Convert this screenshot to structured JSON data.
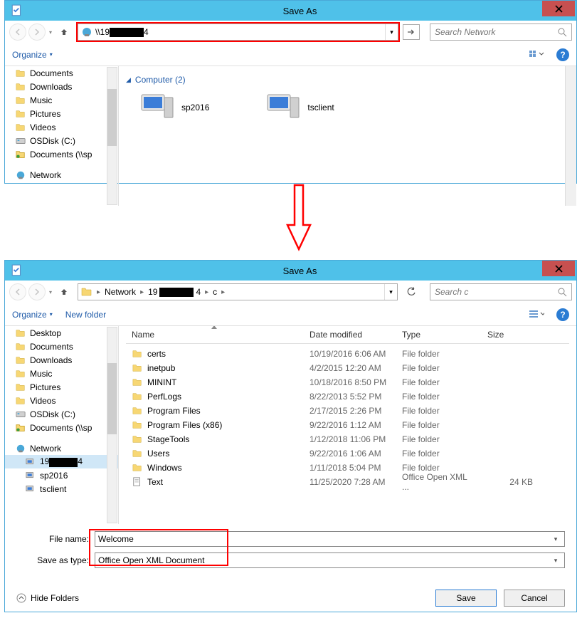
{
  "title": "Save As",
  "close_label": "✕",
  "nav": {
    "address1_prefix": "\\\\19",
    "address1_suffix": "4",
    "search1_placeholder": "Search Network",
    "breadcrumb": [
      "Network",
      "19",
      "c"
    ],
    "bc_redact_suffix": "4",
    "search2_placeholder": "Search c"
  },
  "toolbar": {
    "organize": "Organize",
    "new_folder": "New folder"
  },
  "tree1": [
    {
      "label": "Documents",
      "icon": "folder"
    },
    {
      "label": "Downloads",
      "icon": "folder"
    },
    {
      "label": "Music",
      "icon": "folder"
    },
    {
      "label": "Pictures",
      "icon": "folder"
    },
    {
      "label": "Videos",
      "icon": "folder"
    },
    {
      "label": "OSDisk (C:)",
      "icon": "drive"
    },
    {
      "label": "Documents (\\\\sp",
      "icon": "netfolder"
    }
  ],
  "tree1_network": "Network",
  "group1": {
    "header": "Computer (2)"
  },
  "computers": [
    {
      "label": "sp2016"
    },
    {
      "label": "tsclient"
    }
  ],
  "tree2_top": [
    {
      "label": "Desktop",
      "icon": "folder"
    },
    {
      "label": "Documents",
      "icon": "folder"
    },
    {
      "label": "Downloads",
      "icon": "folder"
    },
    {
      "label": "Music",
      "icon": "folder"
    },
    {
      "label": "Pictures",
      "icon": "folder"
    },
    {
      "label": "Videos",
      "icon": "folder"
    },
    {
      "label": "OSDisk (C:)",
      "icon": "drive"
    },
    {
      "label": "Documents (\\\\sp",
      "icon": "netfolder"
    }
  ],
  "tree2_network": "Network",
  "tree2_children": [
    "19",
    "sp2016",
    "tsclient"
  ],
  "tree2_child0_suffix": "4",
  "list_headers": {
    "name": "Name",
    "date": "Date modified",
    "type": "Type",
    "size": "Size"
  },
  "files": [
    {
      "name": "certs",
      "date": "10/19/2016 6:06 AM",
      "type": "File folder",
      "size": "",
      "icon": "folder"
    },
    {
      "name": "inetpub",
      "date": "4/2/2015 12:20 AM",
      "type": "File folder",
      "size": "",
      "icon": "folder"
    },
    {
      "name": "MININT",
      "date": "10/18/2016 8:50 PM",
      "type": "File folder",
      "size": "",
      "icon": "folder"
    },
    {
      "name": "PerfLogs",
      "date": "8/22/2013 5:52 PM",
      "type": "File folder",
      "size": "",
      "icon": "folder"
    },
    {
      "name": "Program Files",
      "date": "2/17/2015 2:26 PM",
      "type": "File folder",
      "size": "",
      "icon": "folder"
    },
    {
      "name": "Program Files (x86)",
      "date": "9/22/2016 1:12 AM",
      "type": "File folder",
      "size": "",
      "icon": "folder"
    },
    {
      "name": "StageTools",
      "date": "1/12/2018 11:06 PM",
      "type": "File folder",
      "size": "",
      "icon": "folder"
    },
    {
      "name": "Users",
      "date": "9/22/2016 1:06 AM",
      "type": "File folder",
      "size": "",
      "icon": "folder"
    },
    {
      "name": "Windows",
      "date": "1/11/2018 5:04 PM",
      "type": "File folder",
      "size": "",
      "icon": "folder"
    },
    {
      "name": "Text",
      "date": "11/25/2020 7:28 AM",
      "type": "Office Open XML ...",
      "size": "24 KB",
      "icon": "doc"
    }
  ],
  "fields": {
    "filename_label": "File name:",
    "filename_value": "Welcome",
    "saveastype_label": "Save as type:",
    "saveastype_value": "Office Open XML Document"
  },
  "footer": {
    "hide_folders": "Hide Folders",
    "save": "Save",
    "cancel": "Cancel"
  }
}
